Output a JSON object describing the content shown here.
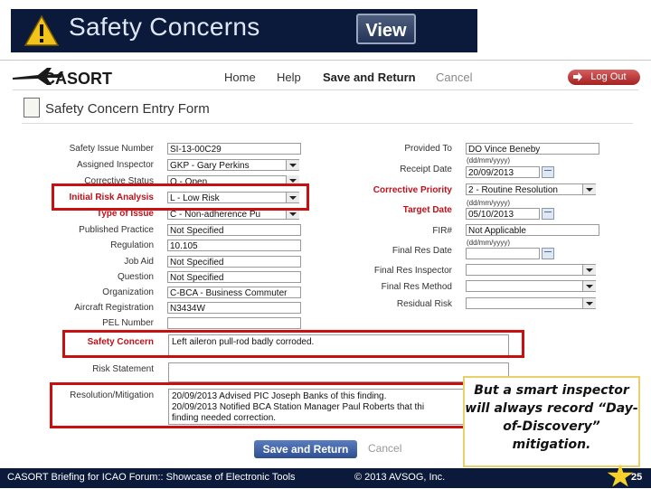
{
  "slide": {
    "title": "Safety Concerns",
    "view_button": "View"
  },
  "app": {
    "logo": "CASORT",
    "nav": {
      "home": "Home",
      "help": "Help",
      "save_return": "Save and Return",
      "cancel": "Cancel"
    },
    "logout": "Log Out"
  },
  "form": {
    "title": "Safety Concern Entry Form",
    "left": {
      "safety_issue_number": {
        "label": "Safety Issue Number",
        "value": "SI-13-00C29"
      },
      "assigned_inspector": {
        "label": "Assigned Inspector",
        "value": "GKP - Gary Perkins"
      },
      "corrective_status": {
        "label": "Corrective Status",
        "value": "O - Open"
      },
      "initial_risk": {
        "label": "Initial Risk Analysis",
        "value": "L - Low Risk"
      },
      "type_of_issue": {
        "label": "Type of Issue",
        "value": "C - Non-adherence Pu"
      },
      "published_practice": {
        "label": "Published Practice",
        "value": "Not Specified"
      },
      "regulation": {
        "label": "Regulation",
        "value": "10.105"
      },
      "job_aid": {
        "label": "Job Aid",
        "value": "Not Specified"
      },
      "question": {
        "label": "Question",
        "value": "Not Specified"
      },
      "organization": {
        "label": "Organization",
        "value": "C-BCA - Business Commuter"
      },
      "aircraft_registration": {
        "label": "Aircraft Registration",
        "value": "N3434W"
      },
      "pel_number": {
        "label": "PEL Number",
        "value": ""
      }
    },
    "right": {
      "provided_to": {
        "label": "Provided To",
        "value": "DO Vince Beneby"
      },
      "receipt_date": {
        "label": "Receipt Date",
        "format": "(dd/mm/yyyy)",
        "value": "20/09/2013"
      },
      "corrective_priority": {
        "label": "Corrective Priority",
        "value": "2 - Routine Resolution"
      },
      "target_date": {
        "label": "Target Date",
        "format": "(dd/mm/yyyy)",
        "value": "05/10/2013"
      },
      "fir": {
        "label": "FIR#",
        "value": "Not Applicable"
      },
      "final_res_date": {
        "label": "Final Res Date",
        "format": "(dd/mm/yyyy)",
        "value": ""
      },
      "final_res_inspector": {
        "label": "Final Res Inspector",
        "value": ""
      },
      "final_res_method": {
        "label": "Final Res Method",
        "value": ""
      },
      "residual_risk": {
        "label": "Residual Risk",
        "value": ""
      }
    },
    "safety_concern": {
      "label": "Safety Concern",
      "value": "Left aileron pull-rod badly corroded."
    },
    "risk_statement": {
      "label": "Risk Statement",
      "value": ""
    },
    "resolution": {
      "label": "Resolution/Mitigation",
      "value": "20/09/2013 Advised PIC Joseph Banks of this finding.\n20/09/2013 Notified BCA Station Manager Paul Roberts that thi\nfinding needed correction."
    },
    "save_button": "Save and Return",
    "cancel_button": "Cancel"
  },
  "callout": "But a smart inspector will always record “Day-of-Discovery” mitigation.",
  "footer": {
    "text": "CASORT Briefing for ICAO Forum:: Showcase of Electronic Tools",
    "copyright": "© 2013 AVSOG, Inc.",
    "page": "25"
  },
  "colors": {
    "header_bg": "#0b1a3a",
    "highlight": "#c81010",
    "label_red": "#c0101b",
    "button_blue": "#2e4f93"
  }
}
